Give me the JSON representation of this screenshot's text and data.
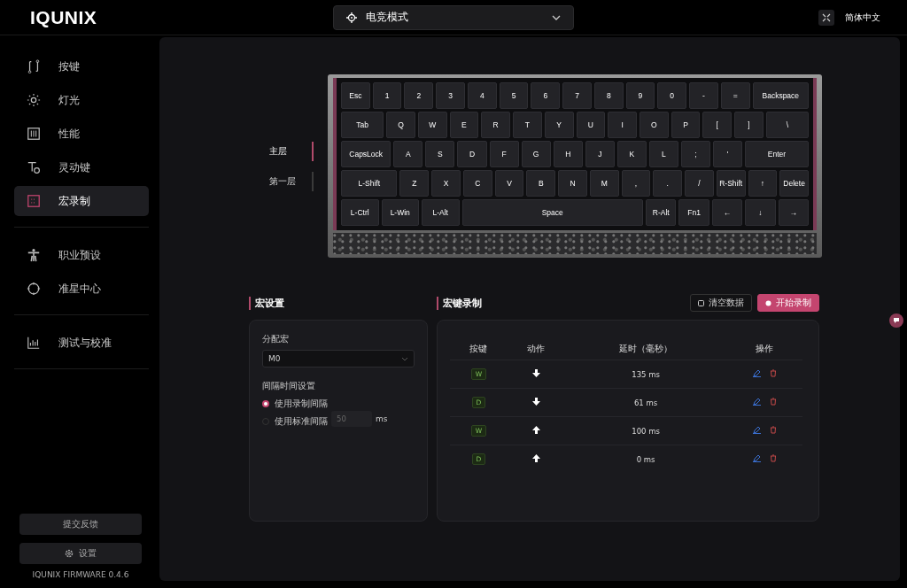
{
  "header": {
    "logo": "IQUNIX",
    "mode_select": {
      "value": "电竞模式"
    },
    "language": "简体中文"
  },
  "sidebar": {
    "groups": [
      [
        {
          "label": "按键",
          "selected": false
        },
        {
          "label": "灯光",
          "selected": false
        },
        {
          "label": "性能",
          "selected": false
        },
        {
          "label": "灵动键",
          "selected": false
        },
        {
          "label": "宏录制",
          "selected": true
        }
      ],
      [
        {
          "label": "职业预设",
          "selected": false
        },
        {
          "label": "准星中心",
          "selected": false
        }
      ],
      [
        {
          "label": "测试与校准",
          "selected": false
        }
      ]
    ],
    "feedback_button": "提交反馈",
    "settings_button": "设置",
    "firmware": "IQUNIX FIRMWARE 0.4.6"
  },
  "layers": [
    {
      "label": "主层",
      "selected": true
    },
    {
      "label": "第一层",
      "selected": false
    }
  ],
  "keyboard": {
    "rows": [
      {
        "keys": [
          {
            "label": "Esc",
            "kind": "u1"
          },
          {
            "label": "1",
            "kind": "u1"
          },
          {
            "label": "2",
            "kind": "u1"
          },
          {
            "label": "3",
            "kind": "u1"
          },
          {
            "label": "4",
            "kind": "u1"
          },
          {
            "label": "5",
            "kind": "u1"
          },
          {
            "label": "6",
            "kind": "u1"
          },
          {
            "label": "7",
            "kind": "u1"
          },
          {
            "label": "8",
            "kind": "u1"
          },
          {
            "label": "9",
            "kind": "u1"
          },
          {
            "label": "0",
            "kind": "u1"
          },
          {
            "label": "-",
            "kind": "u1"
          },
          {
            "label": "=",
            "kind": "u1"
          },
          {
            "label": "Backspace",
            "kind": "u2"
          }
        ]
      },
      {
        "keys": [
          {
            "label": "Tab",
            "kind": "u15"
          },
          {
            "label": "Q",
            "kind": "u1"
          },
          {
            "label": "W",
            "kind": "u1"
          },
          {
            "label": "E",
            "kind": "u1"
          },
          {
            "label": "R",
            "kind": "u1"
          },
          {
            "label": "T",
            "kind": "u1"
          },
          {
            "label": "Y",
            "kind": "u1"
          },
          {
            "label": "U",
            "kind": "u1"
          },
          {
            "label": "I",
            "kind": "u1"
          },
          {
            "label": "O",
            "kind": "u1"
          },
          {
            "label": "P",
            "kind": "u1"
          },
          {
            "label": "[",
            "kind": "u1"
          },
          {
            "label": "]",
            "kind": "u1"
          },
          {
            "label": "\\",
            "kind": "u15"
          }
        ]
      },
      {
        "keys": [
          {
            "label": "CapsLock",
            "kind": "u175"
          },
          {
            "label": "A",
            "kind": "u1"
          },
          {
            "label": "S",
            "kind": "u1"
          },
          {
            "label": "D",
            "kind": "u1"
          },
          {
            "label": "F",
            "kind": "u1"
          },
          {
            "label": "G",
            "kind": "u1"
          },
          {
            "label": "H",
            "kind": "u1"
          },
          {
            "label": "J",
            "kind": "u1"
          },
          {
            "label": "K",
            "kind": "u1"
          },
          {
            "label": "L",
            "kind": "u1"
          },
          {
            "label": ";",
            "kind": "u1"
          },
          {
            "label": "'",
            "kind": "u1"
          },
          {
            "label": "Enter",
            "kind": "u225"
          }
        ]
      },
      {
        "keys": [
          {
            "label": "L-Shift",
            "kind": "u2"
          },
          {
            "label": "Z",
            "kind": "u1"
          },
          {
            "label": "X",
            "kind": "u1"
          },
          {
            "label": "C",
            "kind": "u1"
          },
          {
            "label": "V",
            "kind": "u1"
          },
          {
            "label": "B",
            "kind": "u1"
          },
          {
            "label": "N",
            "kind": "u1"
          },
          {
            "label": "M",
            "kind": "u1"
          },
          {
            "label": ",",
            "kind": "u1"
          },
          {
            "label": ".",
            "kind": "u1"
          },
          {
            "label": "/",
            "kind": "u1"
          },
          {
            "label": "R-Shift",
            "kind": "u1"
          },
          {
            "label": "↑",
            "kind": "u1"
          },
          {
            "label": "Delete",
            "kind": "u1"
          }
        ]
      },
      {
        "keys": [
          {
            "label": "L-Ctrl",
            "kind": "u125"
          },
          {
            "label": "L-Win",
            "kind": "u125"
          },
          {
            "label": "L-Alt",
            "kind": "u125"
          },
          {
            "label": "Space",
            "kind": "u625"
          },
          {
            "label": "R-Alt",
            "kind": "u1"
          },
          {
            "label": "Fn1",
            "kind": "u1"
          },
          {
            "label": "←",
            "kind": "u1"
          },
          {
            "label": "↓",
            "kind": "u1"
          },
          {
            "label": "→",
            "kind": "u1"
          }
        ]
      }
    ]
  },
  "macro_settings": {
    "title": "宏设置",
    "assign_label": "分配宏",
    "assign_value": "M0",
    "interval_label": "间隔时间设置",
    "options": [
      {
        "label": "使用录制间隔",
        "selected": true
      },
      {
        "label": "使用标准间隔",
        "selected": false
      }
    ],
    "standard_interval": {
      "value": "50",
      "unit": "ms"
    }
  },
  "macro_recording": {
    "title": "宏键录制",
    "clear_button": "清空数据",
    "record_button": "开始录制",
    "columns": [
      "按键",
      "动作",
      "延时（毫秒）",
      "操作"
    ],
    "rows": [
      {
        "key": "W",
        "kind": "down",
        "delay": "135 ms"
      },
      {
        "key": "D",
        "kind": "down",
        "delay": "61 ms"
      },
      {
        "key": "W",
        "kind": "up",
        "delay": "100 ms"
      },
      {
        "key": "D",
        "kind": "up",
        "delay": "0 ms"
      }
    ]
  }
}
